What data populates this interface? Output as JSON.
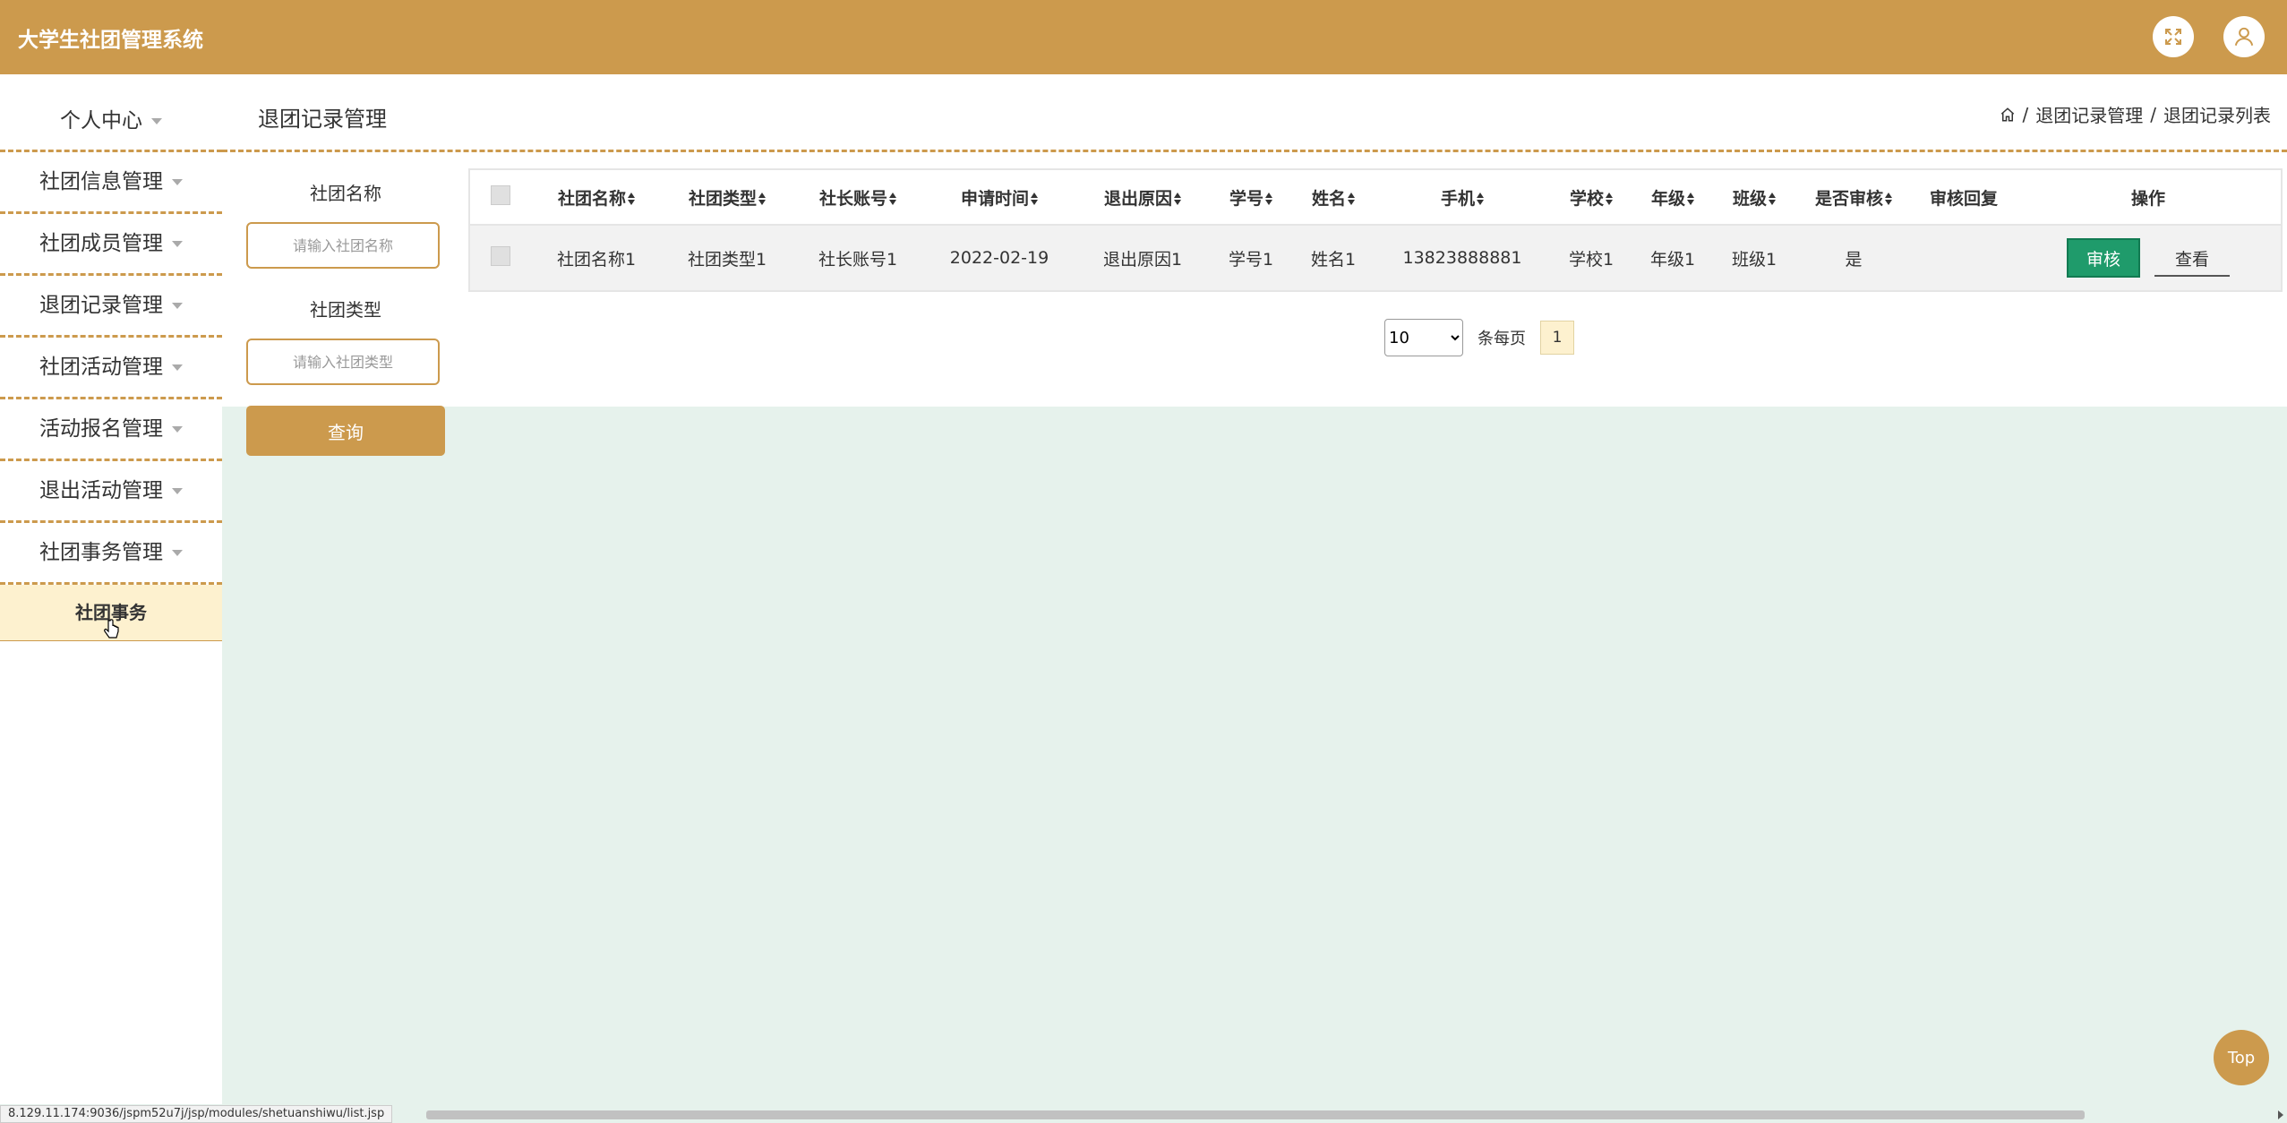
{
  "app": {
    "title": "大学生社团管理系统"
  },
  "topbar": {
    "icons": [
      "fullscreen-icon",
      "user-icon"
    ]
  },
  "sidebar": {
    "items": [
      {
        "label": "个人中心"
      },
      {
        "label": "社团信息管理"
      },
      {
        "label": "社团成员管理"
      },
      {
        "label": "退团记录管理"
      },
      {
        "label": "社团活动管理"
      },
      {
        "label": "活动报名管理"
      },
      {
        "label": "退出活动管理"
      },
      {
        "label": "社团事务管理"
      }
    ],
    "active_sub": {
      "label": "社团事务"
    }
  },
  "header": {
    "title": "退团记录管理",
    "breadcrumb": [
      "退团记录管理",
      "退团记录列表"
    ],
    "separator": "/"
  },
  "search": {
    "club_name_label": "社团名称",
    "club_name_placeholder": "请输入社团名称",
    "club_type_label": "社团类型",
    "club_type_placeholder": "请输入社团类型",
    "query_button": "查询"
  },
  "table": {
    "columns": [
      "社团名称",
      "社团类型",
      "社长账号",
      "申请时间",
      "退出原因",
      "学号",
      "姓名",
      "手机",
      "学校",
      "年级",
      "班级",
      "是否审核",
      "审核回复",
      "操作"
    ],
    "rows": [
      {
        "club_name": "社团名称1",
        "club_type": "社团类型1",
        "leader_account": "社长账号1",
        "apply_time": "2022-02-19",
        "reason": "退出原因1",
        "student_id": "学号1",
        "name": "姓名1",
        "phone": "13823888881",
        "school": "学校1",
        "grade": "年级1",
        "class": "班级1",
        "audited": "是",
        "reply": "",
        "audit_button": "审核",
        "view_button": "查看"
      }
    ]
  },
  "pagination": {
    "page_size": "10",
    "per_page_label": "条每页",
    "current_page": "1"
  },
  "top_button": "Top",
  "status_url": "8.129.11.174:9036/jspm52u7j/jsp/modules/shetuanshiwu/list.jsp",
  "colors": {
    "brand": "#cc9a4d",
    "background": "#e6f2ec",
    "audit_button": "#1f9b6b"
  }
}
